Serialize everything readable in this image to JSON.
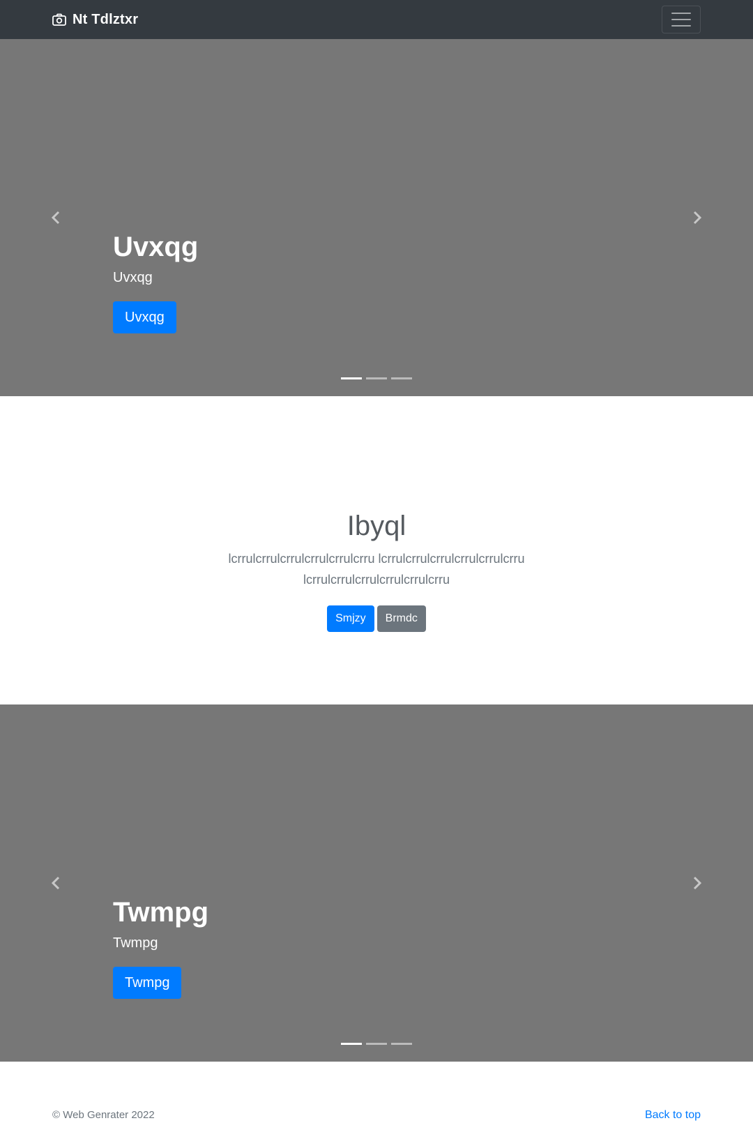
{
  "navbar": {
    "brand": "Nt Tdlztxr",
    "brand_icon": "camera-icon",
    "toggler_icon": "hamburger-icon"
  },
  "carousels": [
    {
      "title": "Uvxqg",
      "subtitle": "Uvxqg",
      "button": "Uvxqg",
      "active_slide": 1,
      "slide_count": 3
    },
    {
      "title": "Twmpg",
      "subtitle": "Twmpg",
      "button": "Twmpg",
      "active_slide": 1,
      "slide_count": 3
    }
  ],
  "hero": {
    "title": "Ibyql",
    "lead": "lcrrulcrrulcrrulcrrulcrrulcrru lcrrulcrrulcrrulcrrulcrrulcrru lcrrulcrrulcrrulcrrulcrrulcrru",
    "primary_button": "Smjzy",
    "secondary_button": "Brmdc"
  },
  "footer": {
    "copyright": "© Web Genrater 2022",
    "back_to_top": "Back to top"
  },
  "colors": {
    "navbar_bg": "#343a40",
    "carousel_bg": "#777777",
    "primary": "#007bff",
    "secondary": "#6c757d"
  }
}
